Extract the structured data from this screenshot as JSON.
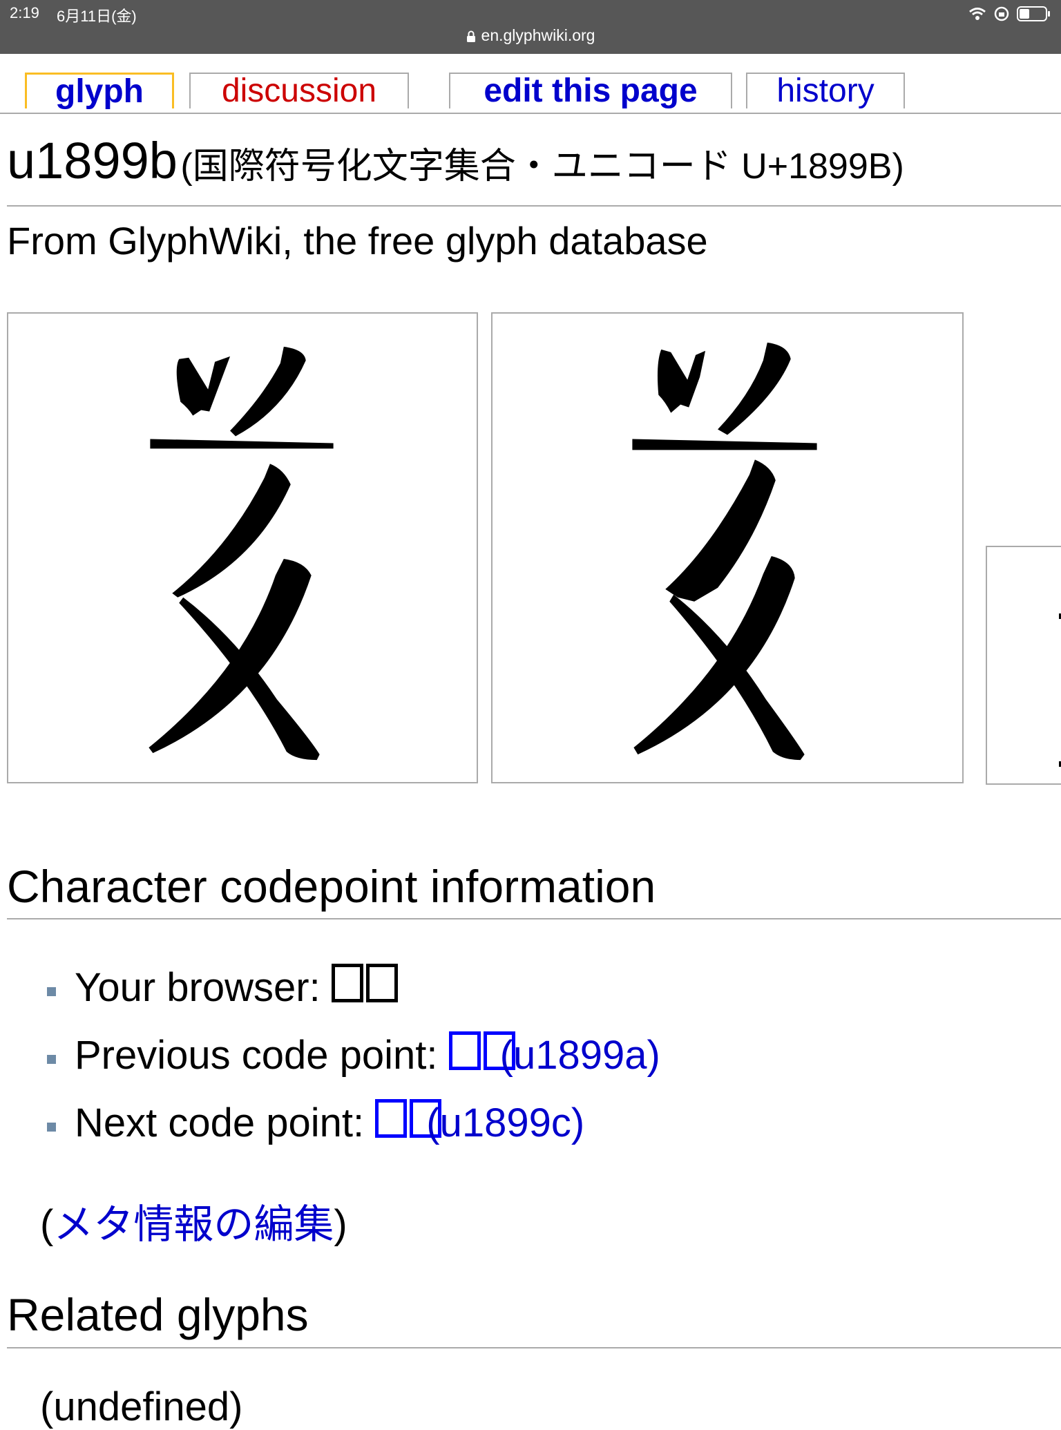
{
  "status": {
    "time": "2:19",
    "date": "6月11日(金)"
  },
  "browser": {
    "url": "en.glyphwiki.org"
  },
  "tabs": [
    {
      "label": "glyph"
    },
    {
      "label": "discussion"
    },
    {
      "label": "edit this page"
    },
    {
      "label": "history"
    }
  ],
  "page": {
    "title_code": "u1899b",
    "title_sub": "(国際符号化文字集合・ユニコード U+1899B)",
    "tagline": "From GlyphWiki, the free glyph database"
  },
  "sections": {
    "codepoint_title": "Character codepoint information",
    "related_title": "Related glyphs"
  },
  "info": {
    "browser_label": "Your browser: ",
    "prev_label": "Previous code point: ",
    "prev_link": "(u1899a)",
    "next_label": "Next code point: ",
    "next_link": "(u1899c)"
  },
  "meta": {
    "open": "(",
    "link": "メタ情報の編集",
    "close": ")"
  },
  "related": {
    "text": "(undefined)"
  },
  "colors": {
    "link": "#0000cc",
    "active_tab_border": "#fabd23",
    "discussion": "#cc0000",
    "bar": "#575757"
  }
}
